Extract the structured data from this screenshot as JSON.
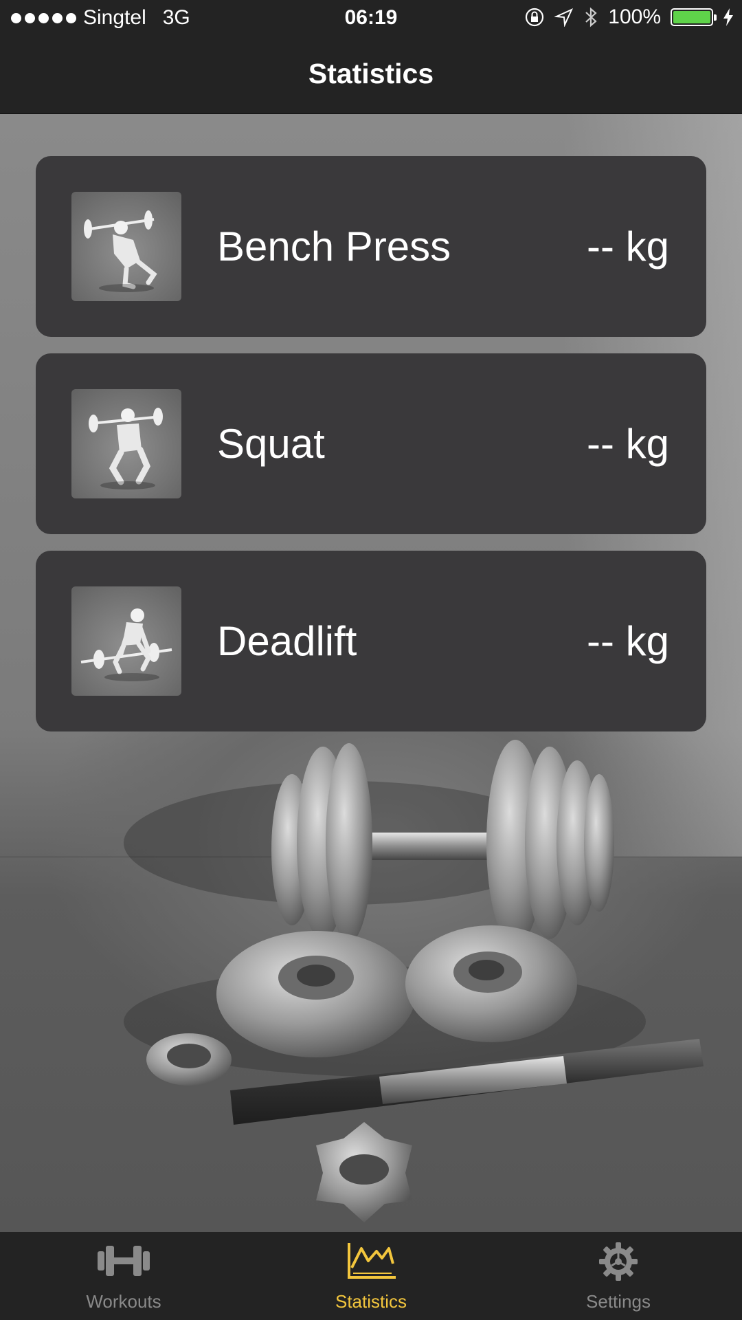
{
  "status_bar": {
    "carrier": "Singtel",
    "network": "3G",
    "time": "06:19",
    "battery": "100%",
    "battery_color": "#5fd34a"
  },
  "nav": {
    "title": "Statistics"
  },
  "exercises": [
    {
      "name": "Bench Press",
      "value": "-- kg",
      "icon": "bench-press-figure-icon"
    },
    {
      "name": "Squat",
      "value": "-- kg",
      "icon": "squat-figure-icon"
    },
    {
      "name": "Deadlift",
      "value": "-- kg",
      "icon": "deadlift-figure-icon"
    }
  ],
  "tabs": [
    {
      "label": "Workouts",
      "icon": "dumbbell-icon",
      "active": false
    },
    {
      "label": "Statistics",
      "icon": "chart-icon",
      "active": true
    },
    {
      "label": "Settings",
      "icon": "gear-icon",
      "active": false
    }
  ],
  "colors": {
    "accent": "#f3c63d",
    "inactive": "#8a8a8a",
    "card": "#3a393b"
  }
}
